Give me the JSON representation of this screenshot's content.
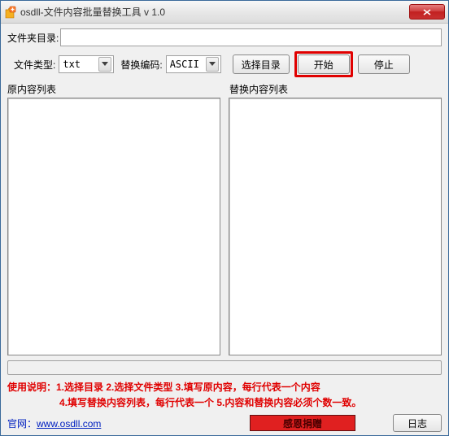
{
  "titlebar": {
    "title": "osdll-文件内容批量替换工具 v 1.0"
  },
  "labels": {
    "dir": "文件夹目录:",
    "filetype": "文件类型:",
    "encoding": "替换编码:",
    "orig_list": "原内容列表",
    "repl_list": "替换内容列表"
  },
  "inputs": {
    "dir_value": "",
    "filetype_value": "txt",
    "encoding_value": "ASCII"
  },
  "buttons": {
    "choose_dir": "选择目录",
    "start": "开始",
    "stop": "停止",
    "donate": "感恩捐赠",
    "log": "日志"
  },
  "instructions": {
    "line1": "使用说明：1.选择目录   2.选择文件类型   3.填写原内容，每行代表一个内容",
    "line2": "4.填写替换内容列表，每行代表一个  5.内容和替换内容必须个数一致。"
  },
  "site": {
    "label": "官网：",
    "url_text": "www.osdll.com"
  }
}
